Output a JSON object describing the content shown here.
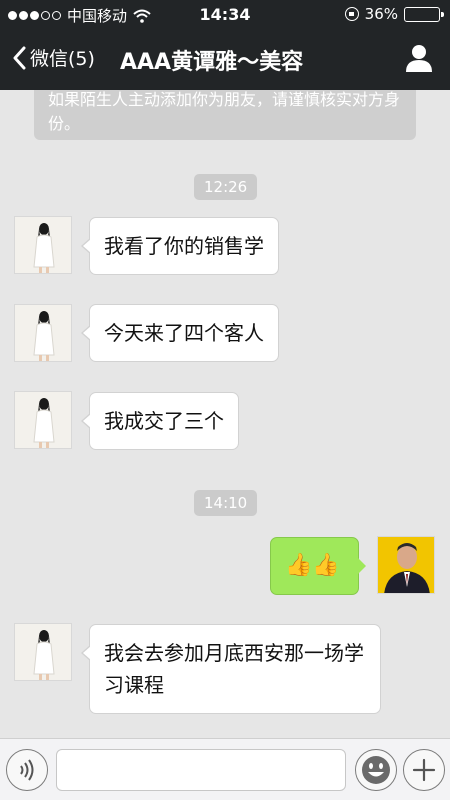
{
  "status_bar": {
    "carrier": "中国移动",
    "time": "14:34",
    "battery": "36%",
    "battery_level": 0.36
  },
  "nav": {
    "back_label": "微信(5)",
    "title": "AAA黄谭雅～美容"
  },
  "chat": {
    "system_notice": "如果陌生人主动添加你为朋友，请谨慎核实对方身份。",
    "timestamps": [
      "12:26",
      "14:10"
    ],
    "messages": [
      {
        "side": "left",
        "text": "我看了你的销售学"
      },
      {
        "side": "left",
        "text": "今天来了四个客人"
      },
      {
        "side": "left",
        "text": "我成交了三个"
      },
      {
        "side": "right",
        "text": "👍👍"
      },
      {
        "side": "left",
        "text": "我会去参加月底西安那一场学习课程"
      }
    ]
  },
  "input_bar": {
    "voice_icon": "voice-icon",
    "emoji_icon": "emoji-icon",
    "plus_icon": "plus-icon",
    "placeholder": ""
  },
  "colors": {
    "header": "#222527",
    "chat_bg": "#e6e6e6",
    "my_bubble": "#9fe85a"
  }
}
